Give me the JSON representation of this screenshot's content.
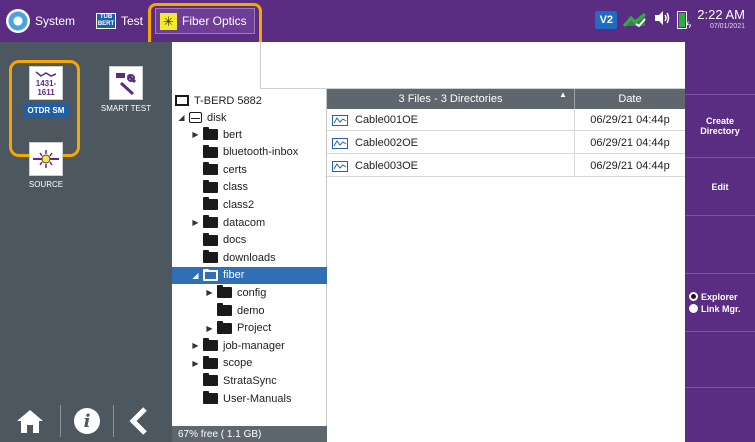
{
  "topbar": {
    "system_label": "System",
    "bert_badge": "TUB BERT",
    "test_label": "Test",
    "fiber_label": "Fiber Optics",
    "status_badge": "V2",
    "time": "2:22 AM",
    "date": "07/01/2021",
    "bg_color": "#5b2d82",
    "highlight_color": "#f5a800"
  },
  "apps": {
    "otdr": {
      "numbers_top": "1431-",
      "numbers_bottom": "1611",
      "label": "OTDR SM"
    },
    "smart_test": {
      "label": "SMART TEST"
    },
    "source": {
      "label": "SOURCE"
    }
  },
  "tree": {
    "root": "T-BERD 5882",
    "disk": "disk",
    "items": [
      {
        "label": "bert",
        "level": 1,
        "expandable": true
      },
      {
        "label": "bluetooth-inbox",
        "level": 1,
        "expandable": false
      },
      {
        "label": "certs",
        "level": 1,
        "expandable": false
      },
      {
        "label": "class",
        "level": 1,
        "expandable": false
      },
      {
        "label": "class2",
        "level": 1,
        "expandable": false
      },
      {
        "label": "datacom",
        "level": 1,
        "expandable": true
      },
      {
        "label": "docs",
        "level": 1,
        "expandable": false
      },
      {
        "label": "downloads",
        "level": 1,
        "expandable": false
      },
      {
        "label": "fiber",
        "level": 1,
        "expanded": true,
        "selected": true
      },
      {
        "label": "config",
        "level": 2,
        "expandable": true
      },
      {
        "label": "demo",
        "level": 2,
        "expandable": false
      },
      {
        "label": "Project",
        "level": 2,
        "expandable": true
      },
      {
        "label": "job-manager",
        "level": 1,
        "expandable": true
      },
      {
        "label": "scope",
        "level": 1,
        "expandable": true
      },
      {
        "label": "StrataSync",
        "level": 1,
        "expandable": false
      },
      {
        "label": "User-Manuals",
        "level": 1,
        "expandable": false
      }
    ],
    "free_space": "67% free ( 1.1 GB)"
  },
  "files": {
    "header_name": "3 Files - 3 Directories",
    "header_date": "Date",
    "rows": [
      {
        "name": "Cable001OE",
        "date": "06/29/21 04:44p"
      },
      {
        "name": "Cable002OE",
        "date": "06/29/21 04:44p"
      },
      {
        "name": "Cable003OE",
        "date": "06/29/21 04:44p"
      }
    ]
  },
  "actions": {
    "create_directory": "Create Directory",
    "edit": "Edit",
    "explorer": "Explorer",
    "link_mgr": "Link Mgr."
  }
}
